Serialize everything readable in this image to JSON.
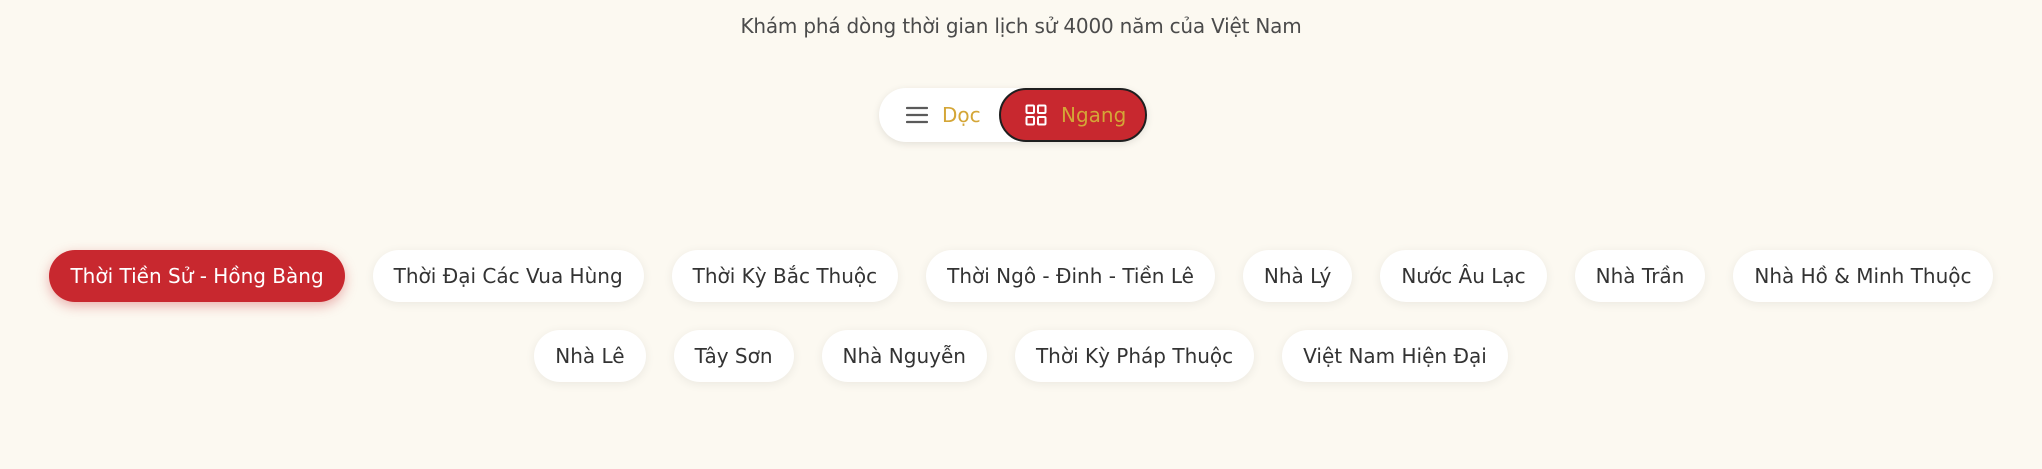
{
  "header": {
    "subtitle": "Khám phá dòng thời gian lịch sử 4000 năm của Việt Nam"
  },
  "view_toggle": {
    "vertical_label": "Dọc",
    "vertical_icon": "menu-lines-icon",
    "horizontal_label": "Ngang",
    "horizontal_icon": "grid-icon",
    "active": "Ngang"
  },
  "eras": {
    "row1": [
      "Thời Tiền Sử - Hồng Bàng",
      "Thời Đại Các Vua Hùng",
      "Thời Kỳ Bắc Thuộc",
      "Thời Ngô - Đinh - Tiền Lê",
      "Nhà Lý",
      "Nước Âu Lạc",
      "Nhà Trần",
      "Nhà Hồ & Minh Thuộc"
    ],
    "row2": [
      "Nhà Lê",
      "Tây Sơn",
      "Nhà Nguyễn",
      "Thời Kỳ Pháp Thuộc",
      "Việt Nam Hiện Đại"
    ],
    "active": "Thời Tiền Sử - Hồng Bàng"
  },
  "colors": {
    "background": "#fcf9f1",
    "accent_red": "#c8282f",
    "accent_gold": "#d4a637"
  }
}
